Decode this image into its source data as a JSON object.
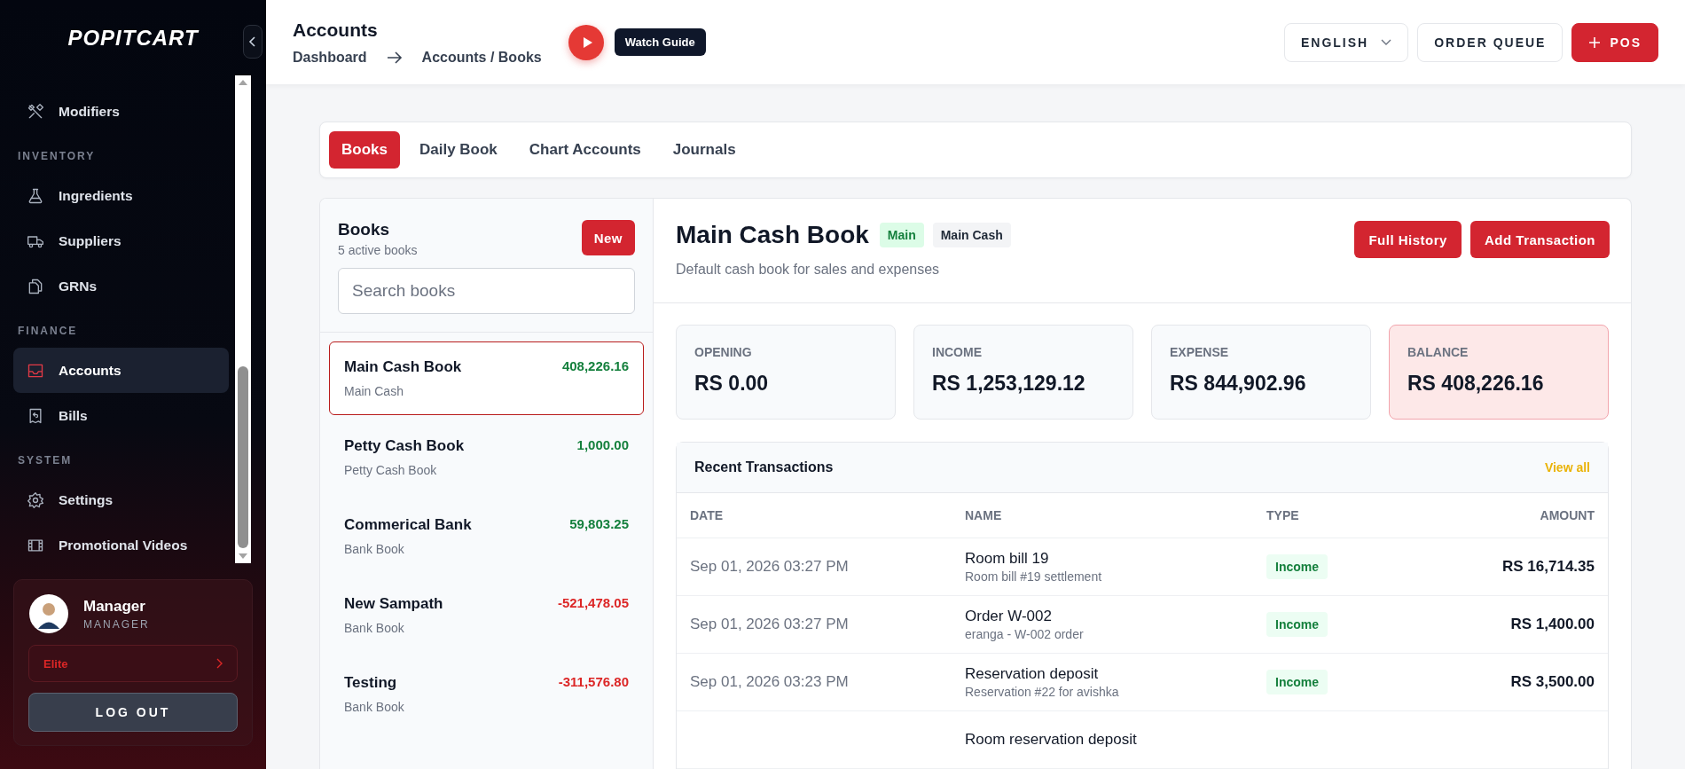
{
  "sidebar": {
    "logo": "POPITCART",
    "sections": [
      {
        "items": [
          {
            "label": "Modifiers",
            "selected": false
          }
        ]
      },
      {
        "heading": "INVENTORY",
        "items": [
          {
            "label": "Ingredients",
            "selected": false
          },
          {
            "label": "Suppliers",
            "selected": false
          },
          {
            "label": "GRNs",
            "selected": false
          }
        ]
      },
      {
        "heading": "FINANCE",
        "items": [
          {
            "label": "Accounts",
            "selected": true
          },
          {
            "label": "Bills",
            "selected": false
          }
        ]
      },
      {
        "heading": "SYSTEM",
        "items": [
          {
            "label": "Settings",
            "selected": false
          },
          {
            "label": "Promotional Videos",
            "selected": false
          }
        ]
      }
    ],
    "user": {
      "name": "Manager",
      "role": "MANAGER",
      "plan": "Elite",
      "logout": "LOG OUT"
    }
  },
  "header": {
    "title": "Accounts",
    "breadcrumb": [
      "Dashboard",
      "Accounts / Books"
    ],
    "guide_tooltip": "Watch Guide",
    "language": "ENGLISH",
    "order_queue": "ORDER QUEUE",
    "pos": "POS"
  },
  "tabs": [
    {
      "label": "Books",
      "selected": true
    },
    {
      "label": "Daily Book",
      "selected": false
    },
    {
      "label": "Chart Accounts",
      "selected": false
    },
    {
      "label": "Journals",
      "selected": false
    }
  ],
  "books_panel": {
    "title": "Books",
    "subtitle": "5 active books",
    "new_button": "New",
    "search": {
      "placeholder": "Search books"
    },
    "books": [
      {
        "name": "Main Cash Book",
        "type": "Main Cash",
        "amount": "408,226.16",
        "color": "#15803d",
        "selected": true
      },
      {
        "name": "Petty Cash Book",
        "type": "Petty Cash Book",
        "amount": "1,000.00",
        "color": "#15803d",
        "selected": false
      },
      {
        "name": "Commerical Bank",
        "type": "Bank Book",
        "amount": "59,803.25",
        "color": "#15803d",
        "selected": false
      },
      {
        "name": "New Sampath",
        "type": "Bank Book",
        "amount": "-521,478.05",
        "color": "#dc2626",
        "selected": false
      },
      {
        "name": "Testing",
        "type": "Bank Book",
        "amount": "-311,576.80",
        "color": "#dc2626",
        "selected": false
      }
    ]
  },
  "detail": {
    "title": "Main Cash Book",
    "badges": [
      {
        "label": "Main",
        "kind": "main"
      },
      {
        "label": "Main Cash",
        "kind": "type"
      }
    ],
    "description": "Default cash book for sales and expenses",
    "buttons": [
      "Full History",
      "Add Transaction"
    ],
    "stats": [
      {
        "label": "OPENING",
        "value": "RS 0.00",
        "highlighted": false
      },
      {
        "label": "INCOME",
        "value": "RS 1,253,129.12",
        "highlighted": false
      },
      {
        "label": "EXPENSE",
        "value": "RS 844,902.96",
        "highlighted": false
      },
      {
        "label": "BALANCE",
        "value": "RS 408,226.16",
        "highlighted": true
      }
    ],
    "transactions": {
      "title": "Recent Transactions",
      "view_all": "View all",
      "columns": [
        "DATE",
        "NAME",
        "TYPE",
        "AMOUNT"
      ],
      "rows": [
        {
          "date": "Sep 01, 2026 03:27 PM",
          "name": "Room bill 19",
          "note": "Room bill #19 settlement",
          "type": "Income",
          "kind": "income",
          "amount": "RS 16,714.35"
        },
        {
          "date": "Sep 01, 2026 03:27 PM",
          "name": "Order W-002",
          "note": "eranga - W-002 order",
          "type": "Income",
          "kind": "income",
          "amount": "RS 1,400.00"
        },
        {
          "date": "Sep 01, 2026 03:23 PM",
          "name": "Reservation deposit",
          "note": "Reservation #22 for avishka",
          "type": "Income",
          "kind": "income",
          "amount": "RS 3,500.00"
        },
        {
          "name": "Room reservation deposit"
        }
      ]
    }
  }
}
